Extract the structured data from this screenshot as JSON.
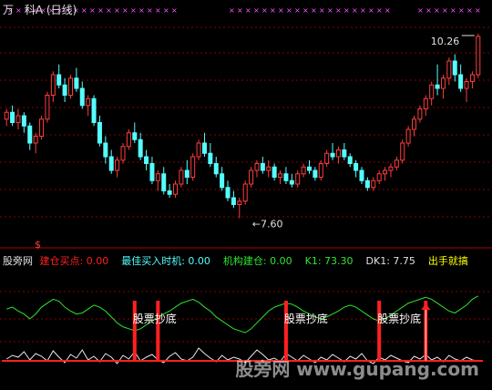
{
  "header": {
    "prefix": "万",
    "stock_name": "科A",
    "period": "(日线)"
  },
  "colors": {
    "background": "#000000",
    "grid": "#8b0000",
    "up_candle": "#ff3d3d",
    "down_candle": "#54ffff",
    "cross_marker": "#ff55ff",
    "ind_green": "#2ee62e",
    "ind_white": "#e8e8e8",
    "ind_red": "#ff2020",
    "label_white": "#ffffff"
  },
  "price_panel": {
    "high_label": "10.26",
    "low_label": "7.60",
    "dollar_mark": "$"
  },
  "indicator_header": {
    "name": "股旁网",
    "items": [
      {
        "label": "建仓买点:",
        "value": "0.00",
        "color": "#ff2020"
      },
      {
        "label": "最佳买入时机:",
        "value": "0.00",
        "color": "#54ffff"
      },
      {
        "label": "机构建仓:",
        "value": "0.00",
        "color": "#2ee62e"
      },
      {
        "label": "K1:",
        "value": "73.30",
        "color": "#2ee62e"
      },
      {
        "label": "DK1:",
        "value": "7.75",
        "color": "#e0e0e0"
      },
      {
        "label": "出手就搞",
        "value": "",
        "color": "#ffff00"
      }
    ]
  },
  "signal_label": "股票抄底",
  "watermark": "股旁网 www.gupang.com",
  "chart_data": {
    "type": "candlestick",
    "y_range": [
      7.3,
      10.5
    ],
    "price_high": 10.26,
    "price_low": 7.6,
    "candles": [
      [
        9.05,
        9.2,
        8.95,
        9.15
      ],
      [
        9.15,
        9.25,
        8.95,
        9.0
      ],
      [
        9.0,
        9.2,
        8.9,
        9.1
      ],
      [
        9.1,
        9.15,
        8.85,
        8.95
      ],
      [
        8.95,
        9.0,
        8.6,
        8.7
      ],
      [
        8.7,
        8.85,
        8.55,
        8.8
      ],
      [
        8.8,
        9.1,
        8.75,
        9.05
      ],
      [
        9.05,
        9.45,
        9.0,
        9.4
      ],
      [
        9.4,
        9.75,
        9.3,
        9.7
      ],
      [
        9.7,
        9.85,
        9.5,
        9.55
      ],
      [
        9.55,
        9.65,
        9.3,
        9.4
      ],
      [
        9.4,
        9.7,
        9.35,
        9.65
      ],
      [
        9.65,
        9.8,
        9.45,
        9.5
      ],
      [
        9.5,
        9.6,
        9.2,
        9.25
      ],
      [
        9.25,
        9.4,
        9.1,
        9.35
      ],
      [
        9.35,
        9.4,
        8.95,
        9.0
      ],
      [
        9.0,
        9.1,
        8.65,
        8.7
      ],
      [
        8.7,
        8.8,
        8.4,
        8.5
      ],
      [
        8.5,
        8.6,
        8.25,
        8.3
      ],
      [
        8.3,
        8.5,
        8.2,
        8.45
      ],
      [
        8.45,
        8.7,
        8.4,
        8.65
      ],
      [
        8.65,
        8.9,
        8.6,
        8.85
      ],
      [
        8.85,
        9.0,
        8.7,
        8.75
      ],
      [
        8.75,
        8.85,
        8.45,
        8.5
      ],
      [
        8.5,
        8.6,
        8.3,
        8.4
      ],
      [
        8.4,
        8.5,
        8.1,
        8.15
      ],
      [
        8.15,
        8.3,
        8.0,
        8.25
      ],
      [
        8.25,
        8.35,
        7.95,
        8.0
      ],
      [
        8.0,
        8.1,
        7.9,
        7.95
      ],
      [
        7.95,
        8.15,
        7.9,
        8.1
      ],
      [
        8.1,
        8.35,
        8.05,
        8.3
      ],
      [
        8.3,
        8.45,
        8.1,
        8.2
      ],
      [
        8.2,
        8.55,
        8.15,
        8.5
      ],
      [
        8.5,
        8.75,
        8.45,
        8.7
      ],
      [
        8.7,
        8.85,
        8.5,
        8.55
      ],
      [
        8.55,
        8.7,
        8.35,
        8.4
      ],
      [
        8.4,
        8.5,
        8.2,
        8.25
      ],
      [
        8.25,
        8.35,
        8.0,
        8.05
      ],
      [
        8.05,
        8.15,
        7.85,
        7.9
      ],
      [
        7.9,
        8.0,
        7.75,
        7.8
      ],
      [
        7.8,
        7.9,
        7.6,
        7.85
      ],
      [
        7.85,
        8.15,
        7.8,
        8.1
      ],
      [
        8.1,
        8.35,
        8.05,
        8.3
      ],
      [
        8.3,
        8.45,
        8.2,
        8.4
      ],
      [
        8.4,
        8.5,
        8.25,
        8.3
      ],
      [
        8.3,
        8.45,
        8.2,
        8.35
      ],
      [
        8.35,
        8.4,
        8.15,
        8.2
      ],
      [
        8.2,
        8.3,
        8.1,
        8.25
      ],
      [
        8.25,
        8.35,
        8.1,
        8.15
      ],
      [
        8.15,
        8.25,
        8.05,
        8.1
      ],
      [
        8.1,
        8.3,
        8.05,
        8.25
      ],
      [
        8.25,
        8.4,
        8.2,
        8.35
      ],
      [
        8.35,
        8.45,
        8.25,
        8.3
      ],
      [
        8.3,
        8.35,
        8.15,
        8.2
      ],
      [
        8.2,
        8.45,
        8.15,
        8.4
      ],
      [
        8.4,
        8.6,
        8.35,
        8.55
      ],
      [
        8.55,
        8.7,
        8.45,
        8.5
      ],
      [
        8.5,
        8.65,
        8.4,
        8.6
      ],
      [
        8.6,
        8.7,
        8.45,
        8.5
      ],
      [
        8.5,
        8.55,
        8.35,
        8.4
      ],
      [
        8.4,
        8.45,
        8.2,
        8.3
      ],
      [
        8.3,
        8.35,
        8.1,
        8.15
      ],
      [
        8.15,
        8.2,
        8.0,
        8.05
      ],
      [
        8.05,
        8.2,
        8.0,
        8.15
      ],
      [
        8.15,
        8.3,
        8.1,
        8.25
      ],
      [
        8.25,
        8.35,
        8.15,
        8.3
      ],
      [
        8.3,
        8.4,
        8.2,
        8.35
      ],
      [
        8.35,
        8.5,
        8.3,
        8.45
      ],
      [
        8.45,
        8.75,
        8.4,
        8.7
      ],
      [
        8.7,
        8.95,
        8.65,
        8.9
      ],
      [
        8.9,
        9.1,
        8.8,
        9.05
      ],
      [
        9.05,
        9.25,
        9.0,
        9.2
      ],
      [
        9.2,
        9.4,
        9.1,
        9.35
      ],
      [
        9.35,
        9.6,
        9.25,
        9.55
      ],
      [
        9.55,
        9.85,
        9.4,
        9.5
      ],
      [
        9.5,
        9.7,
        9.35,
        9.65
      ],
      [
        9.65,
        9.95,
        9.55,
        9.9
      ],
      [
        9.9,
        10.0,
        9.6,
        9.7
      ],
      [
        9.7,
        9.85,
        9.45,
        9.5
      ],
      [
        9.5,
        9.65,
        9.3,
        9.6
      ],
      [
        9.6,
        9.75,
        9.5,
        9.7
      ],
      [
        9.7,
        10.3,
        9.65,
        10.26
      ]
    ],
    "indicator": {
      "green_K1": [
        60,
        62,
        58,
        55,
        50,
        55,
        62,
        66,
        70,
        68,
        62,
        58,
        55,
        56,
        60,
        64,
        62,
        58,
        52,
        46,
        42,
        40,
        38,
        40,
        44,
        48,
        52,
        55,
        58,
        62,
        66,
        68,
        70,
        67,
        62,
        58,
        52,
        48,
        44,
        40,
        38,
        36,
        40,
        46,
        52,
        58,
        62,
        64,
        66,
        65,
        62,
        58,
        55,
        52,
        50,
        52,
        55,
        58,
        62,
        64,
        62,
        58,
        54,
        50,
        48,
        50,
        54,
        58,
        62,
        66,
        68,
        70,
        72,
        70,
        66,
        62,
        58,
        56,
        60,
        64,
        70,
        73.3
      ],
      "white_DK1": [
        10,
        14,
        12,
        18,
        9,
        16,
        13,
        8,
        19,
        12,
        6,
        15,
        11,
        20,
        9,
        13,
        7,
        16,
        12,
        5,
        14,
        10,
        18,
        8,
        12,
        15,
        9,
        6,
        13,
        17,
        10,
        8,
        12,
        22,
        16,
        11,
        7,
        14,
        9,
        12,
        10,
        6,
        13,
        20,
        15,
        9,
        11,
        7,
        16,
        12,
        8,
        14,
        10,
        6,
        12,
        9,
        15,
        11,
        7,
        13,
        10,
        16,
        8,
        5,
        12,
        9,
        14,
        11,
        8,
        6,
        13,
        10,
        15,
        9,
        12,
        7,
        14,
        10,
        8,
        12,
        9,
        7.75
      ],
      "signal_bars": [
        22,
        26,
        48,
        64,
        72,
        96
      ],
      "signal_label_bars": [
        22,
        48,
        64,
        96
      ]
    }
  }
}
